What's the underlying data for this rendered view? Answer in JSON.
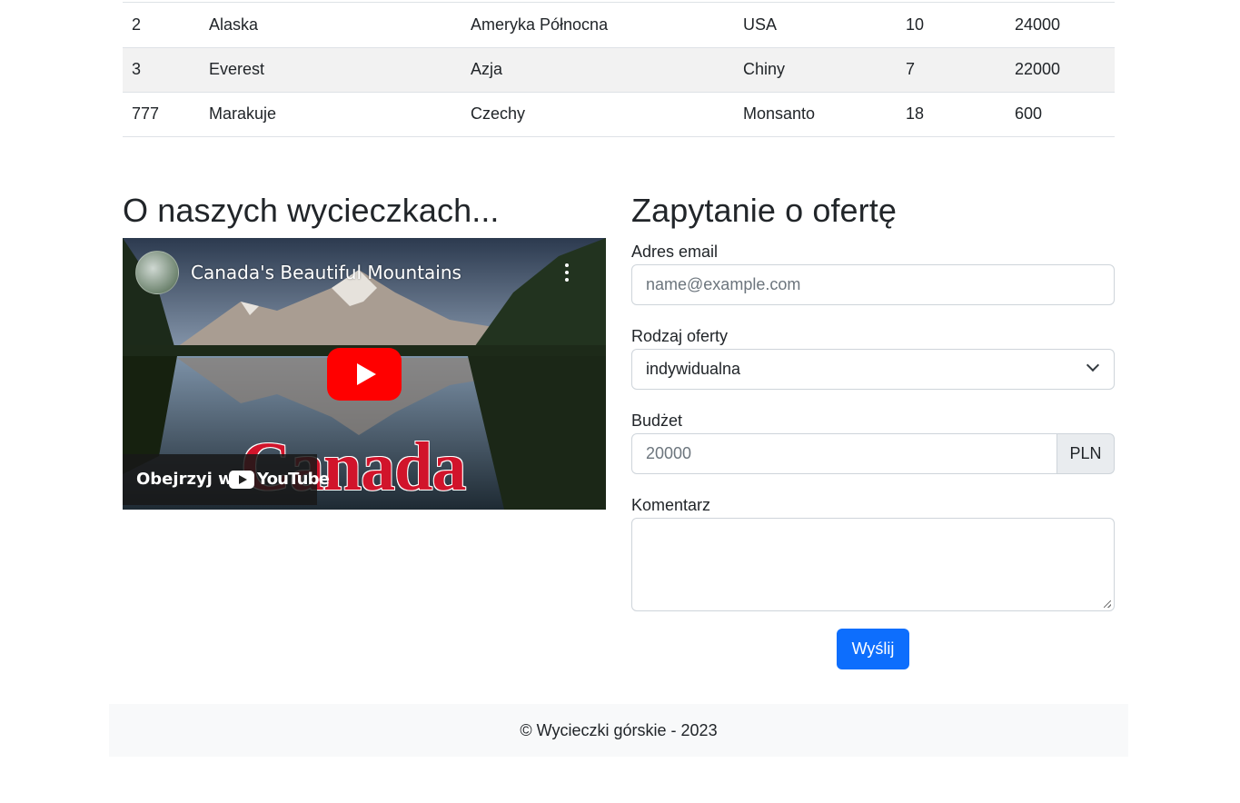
{
  "table": {
    "rows": [
      {
        "id": "2",
        "name": "Alaska",
        "continent": "Ameryka Północna",
        "country": "USA",
        "days": "10",
        "price": "24000"
      },
      {
        "id": "3",
        "name": "Everest",
        "continent": "Azja",
        "country": "Chiny",
        "days": "7",
        "price": "22000"
      },
      {
        "id": "777",
        "name": "Marakuje",
        "continent": "Czechy",
        "country": "Monsanto",
        "days": "18",
        "price": "600"
      }
    ]
  },
  "about": {
    "heading": "O naszych wycieczkach...",
    "video": {
      "title": "Canada's Beautiful Mountains",
      "overlay_text": "Canada",
      "watch_on": "Obejrzyj w",
      "youtube": "YouTube"
    }
  },
  "form": {
    "heading": "Zapytanie o ofertę",
    "email_label": "Adres email",
    "email_placeholder": "name@example.com",
    "offer_label": "Rodzaj oferty",
    "offer_value": "indywidualna",
    "budget_label": "Budżet",
    "budget_placeholder": "20000",
    "budget_addon": "PLN",
    "comment_label": "Komentarz",
    "submit_label": "Wyślij"
  },
  "footer": {
    "text": "© Wycieczki górskie - 2023"
  },
  "colors": {
    "primary": "#0d6efd",
    "youtube_red": "#ff0000",
    "footer_bg": "#f8f9fa"
  }
}
